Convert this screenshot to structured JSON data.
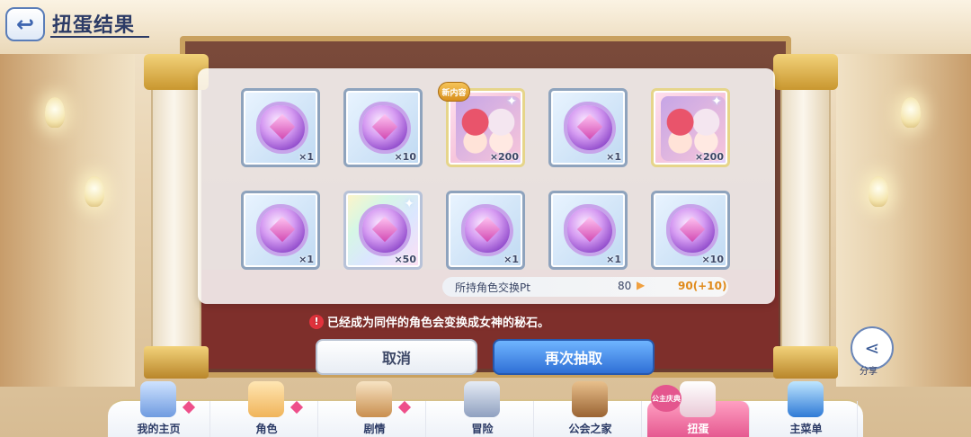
{
  "header": {
    "title": "扭蛋结果"
  },
  "results": [
    {
      "type": "stone",
      "count": "×1"
    },
    {
      "type": "stone",
      "count": "×10"
    },
    {
      "type": "character",
      "count": "×200",
      "badge": "新内容"
    },
    {
      "type": "stone",
      "count": "×1"
    },
    {
      "type": "character",
      "count": "×200"
    },
    {
      "type": "stone",
      "count": "×1"
    },
    {
      "type": "stone-rainbow",
      "count": "×50"
    },
    {
      "type": "stone",
      "count": "×1"
    },
    {
      "type": "stone",
      "count": "×1"
    },
    {
      "type": "stone",
      "count": "×10"
    }
  ],
  "pt": {
    "label": "所持角色交换Pt",
    "old": "80",
    "new": "90(+10)",
    "accent": "#e08a1a"
  },
  "warning": {
    "text": "已经成为同伴的角色会变换成女神的秘石。",
    "icon": "!"
  },
  "buttons": {
    "cancel": "取消",
    "again": "再次抽取"
  },
  "share": {
    "label": "分享"
  },
  "nav": {
    "items": [
      {
        "label": "我的主页",
        "icon": "castle-icon",
        "dot": true
      },
      {
        "label": "角色",
        "icon": "character-icon",
        "dot": true
      },
      {
        "label": "剧情",
        "icon": "scroll-icon",
        "dot": true
      },
      {
        "label": "冒险",
        "icon": "sword-icon",
        "dot": false
      },
      {
        "label": "公会之家",
        "icon": "door-icon",
        "dot": false
      },
      {
        "label": "扭蛋",
        "icon": "gacha-icon",
        "dot": false,
        "active": true,
        "tag": "公主庆典"
      },
      {
        "label": "主菜单",
        "icon": "crystal-icon",
        "dot": false
      }
    ]
  }
}
